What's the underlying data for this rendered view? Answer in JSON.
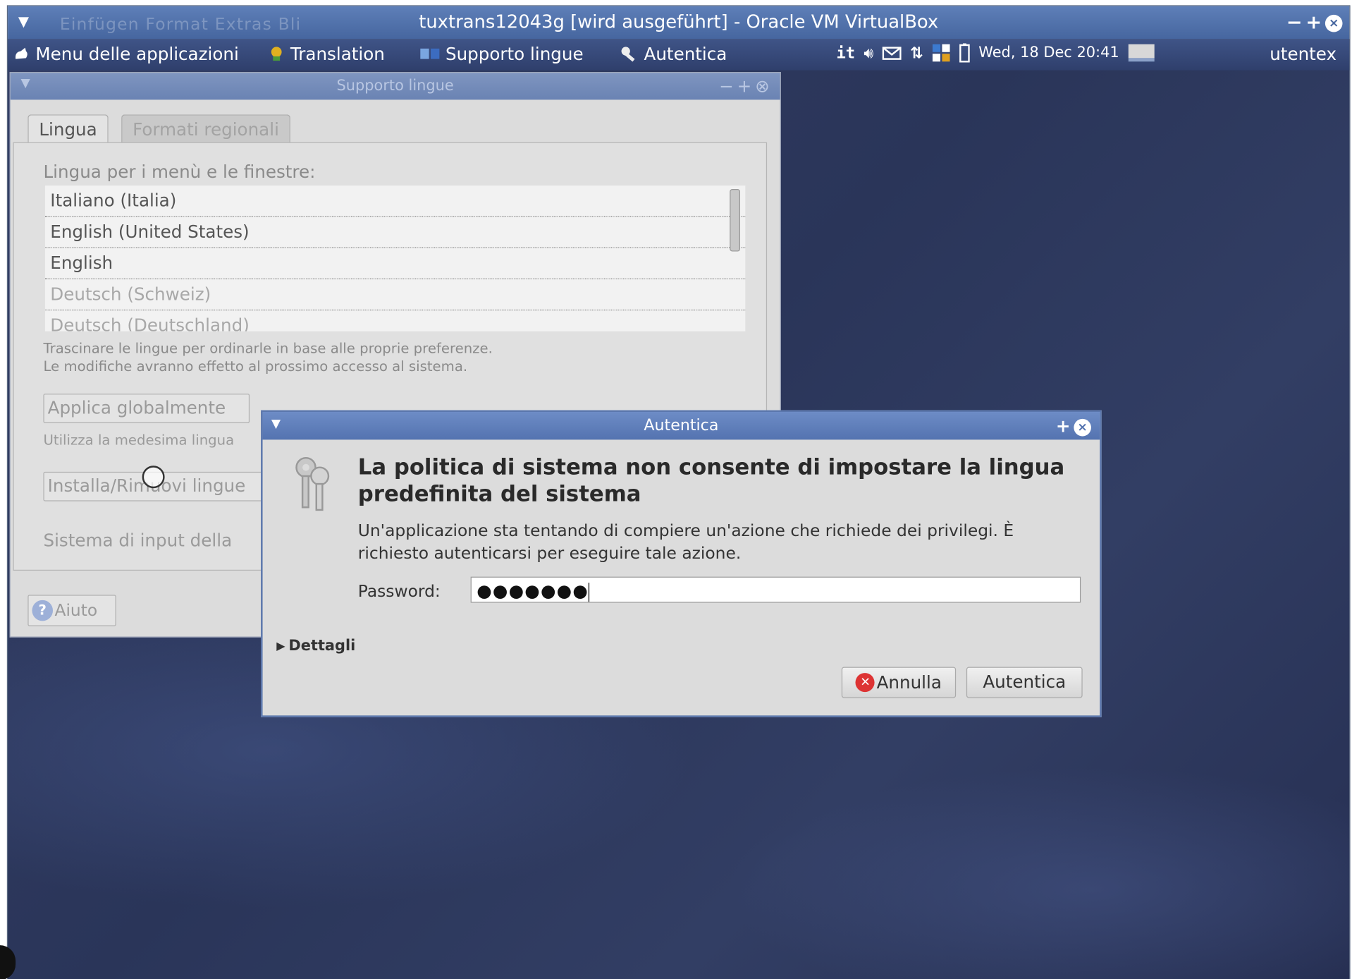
{
  "host_window": {
    "title": "tuxtrans12043g [wird ausgeführt] - Oracle VM VirtualBox",
    "ghost_menu": "Einfügen   Format   Extras   Bli"
  },
  "panel": {
    "apps_menu": "Menu delle applicazioni",
    "translation": "Translation",
    "supporto": "Supporto lingue",
    "autentica": "Autentica",
    "keyboard_layout": "it",
    "clock": "Wed, 18 Dec 20:41",
    "user": "utentex"
  },
  "lang_window": {
    "title": "Supporto lingue",
    "tabs": [
      "Lingua",
      "Formati regionali"
    ],
    "list_label": "Lingua per i menù e le finestre:",
    "languages": [
      {
        "label": "Italiano (Italia)",
        "dim": false
      },
      {
        "label": "English (United States)",
        "dim": false
      },
      {
        "label": "English",
        "dim": false
      },
      {
        "label": "Deutsch (Schweiz)",
        "dim": true
      },
      {
        "label": "Deutsch (Deutschland)",
        "dim": true
      }
    ],
    "hint_line1": "Trascinare le lingue per ordinarle in base alle proprie preferenze.",
    "hint_line2": "Le modifiche avranno effetto al prossimo accesso al sistema.",
    "apply_button": "Applica globalmente",
    "utilizza_text": "Utilizza la medesima lingua",
    "install_button": "Installa/Rimuovi lingue",
    "input_system_label": "Sistema di input della",
    "help_button": "Aiuto"
  },
  "auth_dialog": {
    "title": "Autentica",
    "heading": "La politica di sistema non consente di impostare la lingua predefinita del sistema",
    "message": "Un'applicazione sta tentando di compiere un'azione che richiede dei privilegi. È richiesto autenticarsi per eseguire tale azione.",
    "password_label": "Password:",
    "password_value": "●●●●●●●",
    "details_label": "Dettagli",
    "cancel_button": "Annulla",
    "confirm_button": "Autentica"
  },
  "colors": {
    "title_bar": "#5473b0",
    "desktop": "#2e3a5e",
    "dialog_bg": "#dcdcdc"
  },
  "icons": [
    "window-menu-icon",
    "xfce-mouse-icon",
    "translation-icon",
    "supporto-lingue-icon",
    "key-icon",
    "volume-icon",
    "mail-icon",
    "network-icon",
    "workspace-switcher-icon",
    "battery-icon",
    "display-icon",
    "keys-icon",
    "help-icon",
    "cancel-icon",
    "expander-arrow-icon",
    "close-icon"
  ]
}
